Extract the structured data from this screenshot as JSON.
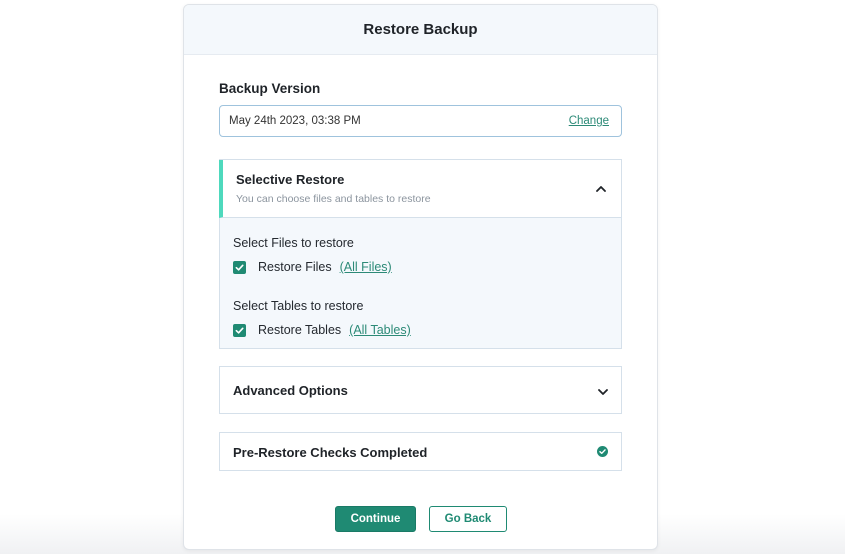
{
  "modal": {
    "title": "Restore Backup"
  },
  "backup_version": {
    "label": "Backup Version",
    "value": "May 24th 2023, 03:38 PM",
    "change_label": "Change"
  },
  "selective_restore": {
    "title": "Selective Restore",
    "subtitle": "You can choose files and tables to restore",
    "expanded": true,
    "files_label": "Select Files to restore",
    "files_option": {
      "label": "Restore Files",
      "link": "(All Files)",
      "checked": true
    },
    "tables_label": "Select Tables to restore",
    "tables_option": {
      "label": "Restore Tables",
      "link": "(All Tables)",
      "checked": true
    }
  },
  "advanced_options": {
    "title": "Advanced Options",
    "expanded": false
  },
  "pre_restore": {
    "title": "Pre-Restore Checks Completed",
    "status": "completed"
  },
  "buttons": {
    "continue_label": "Continue",
    "go_back_label": "Go Back"
  },
  "colors": {
    "accent": "#1f8a73",
    "selected_bar": "#4ed9bd",
    "header_bg": "#f4f8fc",
    "version_border": "#9fc3dd"
  }
}
